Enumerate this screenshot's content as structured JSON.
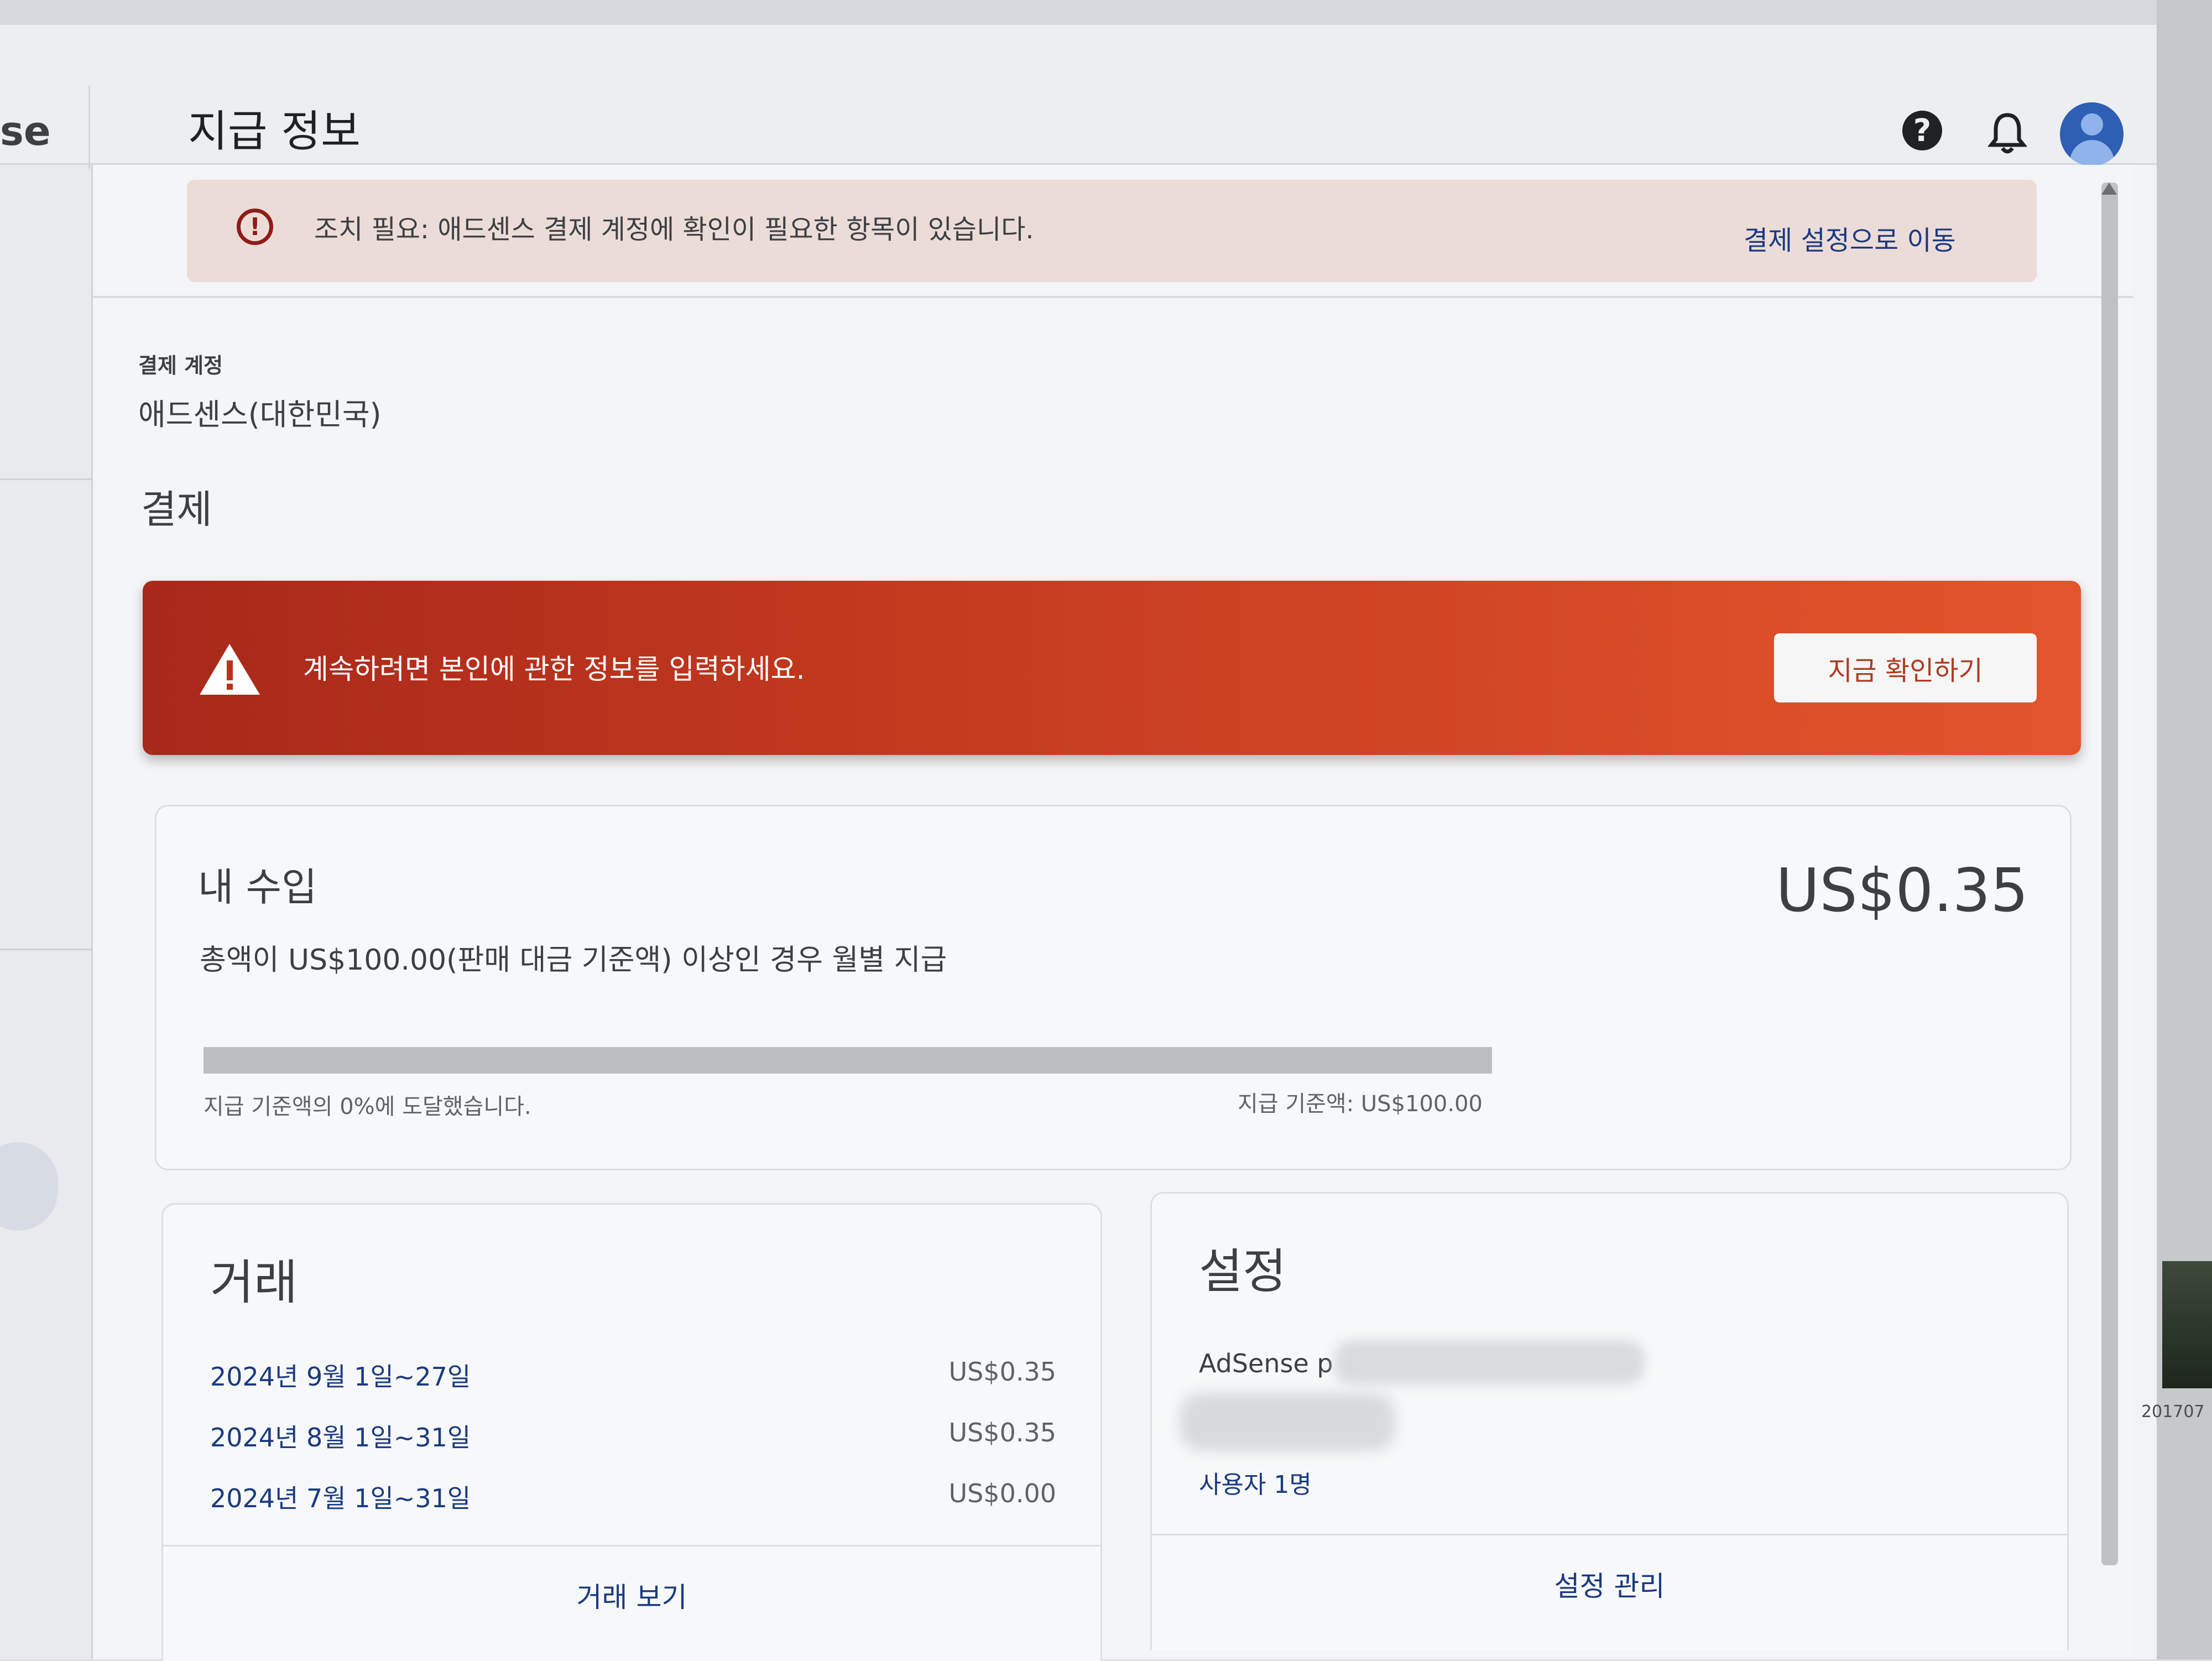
{
  "app": {
    "brand_fragment": "se",
    "page_title": "지급 정보"
  },
  "header_icons": {
    "help": "help-icon",
    "notifications": "bell-icon",
    "account": "account-avatar"
  },
  "notice": {
    "text": "조치 필요: 애드센스 결제 계정에 확인이 필요한 항목이 있습니다.",
    "link": "결제 설정으로 이동"
  },
  "account": {
    "label": "결제 계정",
    "value": "애드센스(대한민국)"
  },
  "payments": {
    "heading": "결제"
  },
  "alert": {
    "text": "계속하려면 본인에 관한 정보를 입력하세요.",
    "button": "지금 확인하기",
    "color": "#c43a1f"
  },
  "earnings": {
    "title": "내 수입",
    "amount": "US$0.35",
    "description": "총액이 US$100.00(판매 대금 기준액) 이상인 경우 월별 지급",
    "progress_percent": 0,
    "progress_label": "지급 기준액의 0%에 도달했습니다.",
    "threshold_label": "지급 기준액: US$100.00"
  },
  "transactions": {
    "title": "거래",
    "rows": [
      {
        "date": "2024년 9월 1일~27일",
        "amount": "US$0.35"
      },
      {
        "date": "2024년 8월 1일~31일",
        "amount": "US$0.35"
      },
      {
        "date": "2024년 7월 1일~31일",
        "amount": "US$0.00"
      }
    ],
    "view_link": "거래 보기"
  },
  "settings": {
    "title": "설정",
    "line1": "AdSense p",
    "users": "사용자 1명",
    "manage_link": "설정 관리"
  },
  "desktop": {
    "label": "201707"
  },
  "colors": {
    "link": "#1a3a80",
    "alert_dark": "#a8281a",
    "alert_light": "#e2552c",
    "avatar": "#2f5fb3"
  }
}
